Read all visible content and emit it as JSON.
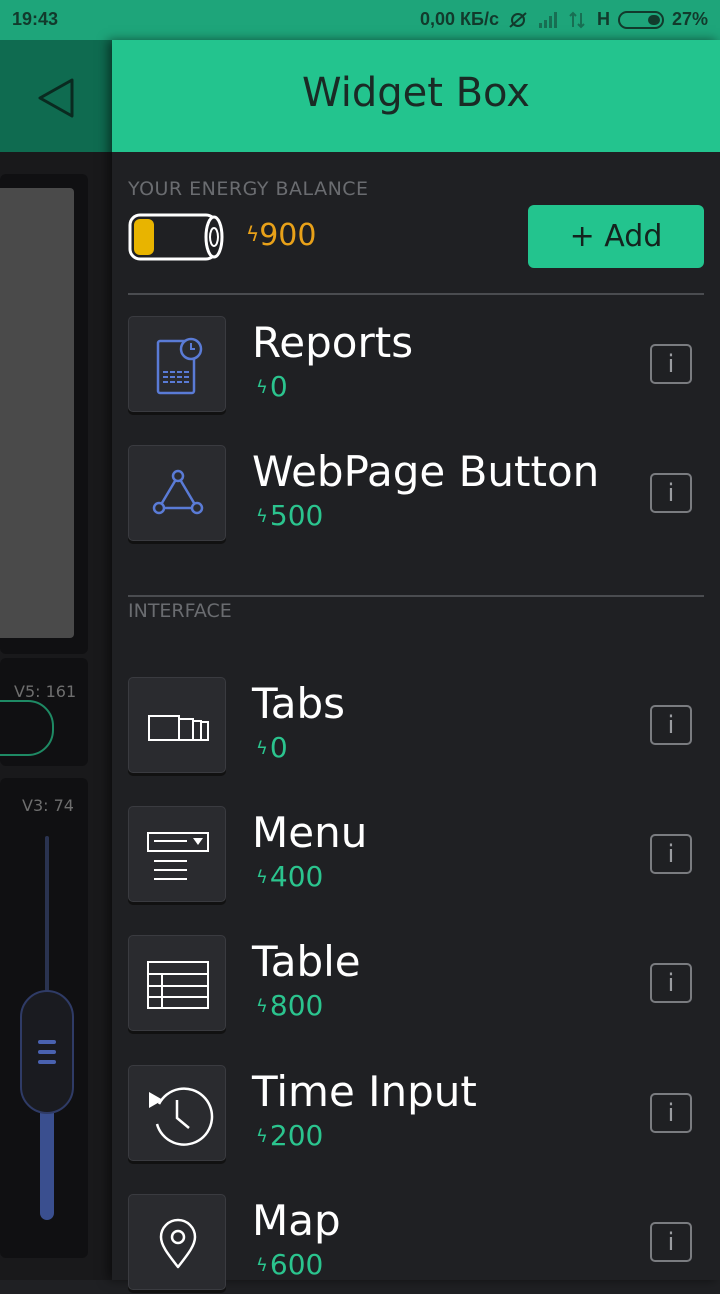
{
  "status_bar": {
    "time": "19:43",
    "network_speed": "0,00 КБ/с",
    "network_type": "H",
    "battery_percent": "27%"
  },
  "background_app": {
    "v5_label": "V5: 161",
    "v3_label": "V3: 74"
  },
  "drawer": {
    "title": "Widget Box",
    "energy": {
      "label": "YOUR ENERGY BALANCE",
      "value": "900",
      "add_label": "+ Add",
      "bolt_color": "#e8a119"
    },
    "widgets_top": [
      {
        "name": "Reports",
        "cost": "0",
        "icon": "reports-icon"
      },
      {
        "name": "WebPage Button",
        "cost": "500",
        "icon": "share-nodes-icon"
      }
    ],
    "interface_section": {
      "label": "INTERFACE",
      "widgets": [
        {
          "name": "Tabs",
          "cost": "0",
          "icon": "tabs-icon"
        },
        {
          "name": "Menu",
          "cost": "400",
          "icon": "menu-icon"
        },
        {
          "name": "Table",
          "cost": "800",
          "icon": "table-icon"
        },
        {
          "name": "Time Input",
          "cost": "200",
          "icon": "time-input-icon"
        },
        {
          "name": "Map",
          "cost": "600",
          "icon": "map-pin-icon"
        }
      ]
    },
    "info_label": "i",
    "colors": {
      "accent": "#23c48e",
      "energy": "#e8a119",
      "icon_blue": "#5a7bd6"
    }
  }
}
